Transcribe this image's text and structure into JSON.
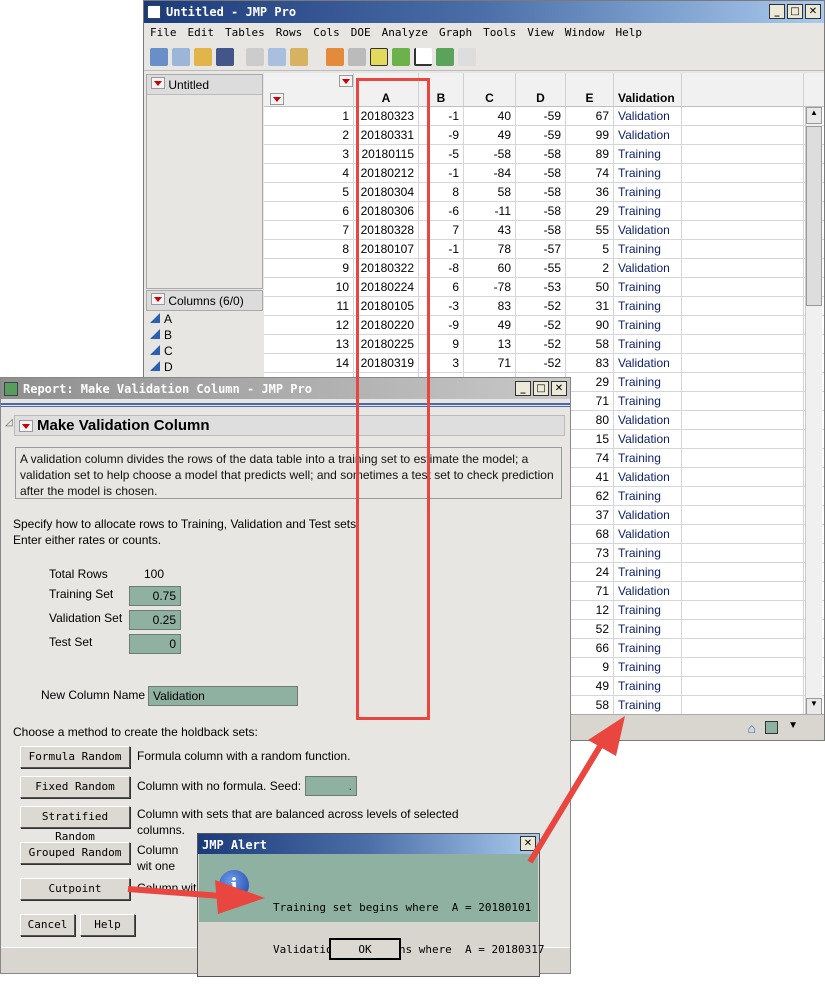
{
  "table_window": {
    "title": "Untitled - JMP Pro",
    "menu": [
      "File",
      "Edit",
      "Tables",
      "Rows",
      "Cols",
      "DOE",
      "Analyze",
      "Graph",
      "Tools",
      "View",
      "Window",
      "Help"
    ],
    "panel_title": "Untitled",
    "columns_panel_title": "Columns (6/0)",
    "column_list": [
      "A",
      "B",
      "C",
      "D"
    ],
    "headers": [
      "A",
      "B",
      "C",
      "D",
      "E",
      "Validation"
    ],
    "rows": [
      [
        "1",
        "20180323",
        "-1",
        "40",
        "-59",
        "67",
        "Validation"
      ],
      [
        "2",
        "20180331",
        "-9",
        "49",
        "-59",
        "99",
        "Validation"
      ],
      [
        "3",
        "20180115",
        "-5",
        "-58",
        "-58",
        "89",
        "Training"
      ],
      [
        "4",
        "20180212",
        "-1",
        "-84",
        "-58",
        "74",
        "Training"
      ],
      [
        "5",
        "20180304",
        "8",
        "58",
        "-58",
        "36",
        "Training"
      ],
      [
        "6",
        "20180306",
        "-6",
        "-11",
        "-58",
        "29",
        "Training"
      ],
      [
        "7",
        "20180328",
        "7",
        "43",
        "-58",
        "55",
        "Validation"
      ],
      [
        "8",
        "20180107",
        "-1",
        "78",
        "-57",
        "5",
        "Training"
      ],
      [
        "9",
        "20180322",
        "-8",
        "60",
        "-55",
        "2",
        "Validation"
      ],
      [
        "10",
        "20180224",
        "6",
        "-78",
        "-53",
        "50",
        "Training"
      ],
      [
        "11",
        "20180105",
        "-3",
        "83",
        "-52",
        "31",
        "Training"
      ],
      [
        "12",
        "20180220",
        "-9",
        "49",
        "-52",
        "90",
        "Training"
      ],
      [
        "13",
        "20180225",
        "9",
        "13",
        "-52",
        "58",
        "Training"
      ],
      [
        "14",
        "20180319",
        "3",
        "71",
        "-52",
        "83",
        "Validation"
      ],
      [
        "",
        "",
        "",
        "",
        "",
        "29",
        "Training"
      ],
      [
        "",
        "",
        "",
        "",
        "",
        "71",
        "Training"
      ],
      [
        "",
        "",
        "",
        "",
        "",
        "80",
        "Validation"
      ],
      [
        "",
        "",
        "",
        "",
        "",
        "15",
        "Validation"
      ],
      [
        "",
        "",
        "",
        "",
        "",
        "74",
        "Training"
      ],
      [
        "",
        "",
        "",
        "",
        "",
        "41",
        "Validation"
      ],
      [
        "",
        "",
        "",
        "",
        "",
        "62",
        "Training"
      ],
      [
        "",
        "",
        "",
        "",
        "",
        "37",
        "Validation"
      ],
      [
        "",
        "",
        "",
        "",
        "",
        "68",
        "Validation"
      ],
      [
        "",
        "",
        "",
        "",
        "",
        "73",
        "Training"
      ],
      [
        "",
        "",
        "",
        "",
        "",
        "24",
        "Training"
      ],
      [
        "",
        "",
        "",
        "",
        "",
        "71",
        "Validation"
      ],
      [
        "",
        "",
        "",
        "",
        "",
        "12",
        "Training"
      ],
      [
        "",
        "",
        "",
        "",
        "",
        "52",
        "Training"
      ],
      [
        "",
        "",
        "",
        "",
        "",
        "66",
        "Training"
      ],
      [
        "",
        "",
        "",
        "",
        "",
        "9",
        "Training"
      ],
      [
        "",
        "",
        "",
        "",
        "",
        "49",
        "Training"
      ],
      [
        "",
        "",
        "",
        "",
        "",
        "58",
        "Training"
      ]
    ]
  },
  "report": {
    "title": "Report: Make Validation Column - JMP Pro",
    "heading": "Make Validation Column",
    "description": "A validation column divides the rows of the data table into a training set to estimate the model; a validation set to help choose a model that predicts well; and sometimes a test set to check prediction after the model is chosen.",
    "instructions1": "Specify how to allocate rows to Training, Validation and Test sets.",
    "instructions2": "Enter either rates or counts.",
    "total_rows_label": "Total Rows",
    "total_rows": "100",
    "training_label": "Training Set",
    "training_value": "0.75",
    "validation_label": "Validation Set",
    "validation_value": "0.25",
    "test_label": "Test Set",
    "test_value": "0",
    "new_col_label": "New Column Name",
    "new_col_value": "Validation",
    "method_prompt": "Choose a method to create the holdback sets:",
    "methods": [
      {
        "label": "Formula Random",
        "desc": "Formula column with a random function."
      },
      {
        "label": "Fixed Random",
        "desc": "Column with no formula. Seed:"
      },
      {
        "label": "Stratified Random",
        "desc": "Column with sets that are balanced across levels of selected columns."
      },
      {
        "label": "Grouped Random",
        "desc": "Column wit one set."
      },
      {
        "label": "Cutpoint",
        "desc": "Column wit"
      }
    ],
    "seed_value": ".",
    "cancel": "Cancel",
    "help": "Help"
  },
  "alert": {
    "title": "JMP Alert",
    "line1": "Training set begins where  A = 20180101",
    "line2": "Validation set begins where  A = 20180317",
    "ok": "OK"
  },
  "colors": {
    "field": "#8fb1a1",
    "annotation": "#e8463f",
    "text_blue": "#0c1f6b"
  }
}
